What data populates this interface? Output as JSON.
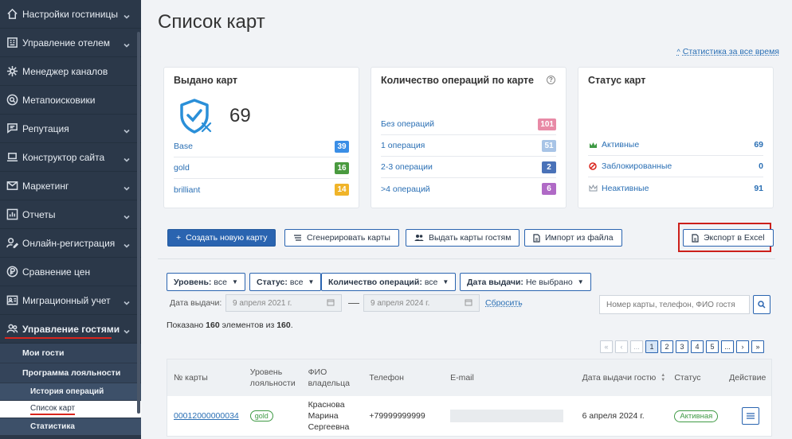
{
  "sidebar": {
    "items": [
      {
        "label": "Настройки гостиницы",
        "icon": "home-icon",
        "chevron": true
      },
      {
        "label": "Управление отелем",
        "icon": "building-icon",
        "chevron": true
      },
      {
        "label": "Менеджер каналов",
        "icon": "network-icon",
        "chevron": false
      },
      {
        "label": "Метапоисковики",
        "icon": "search-circle-icon",
        "chevron": false
      },
      {
        "label": "Репутация",
        "icon": "chat-icon",
        "chevron": true
      },
      {
        "label": "Конструктор сайта",
        "icon": "laptop-icon",
        "chevron": true
      },
      {
        "label": "Маркетинг",
        "icon": "mail-icon",
        "chevron": true
      },
      {
        "label": "Отчеты",
        "icon": "chart-icon",
        "chevron": true
      },
      {
        "label": "Онлайн-регистрация",
        "icon": "user-edit-icon",
        "chevron": true
      },
      {
        "label": "Сравнение цен",
        "icon": "price-icon",
        "chevron": false
      },
      {
        "label": "Миграционный учет",
        "icon": "id-card-icon",
        "chevron": true
      },
      {
        "label": "Управление гостями",
        "icon": "users-icon",
        "chevron": true
      }
    ],
    "sub_items": [
      "Мои гости",
      "Программа лояльности"
    ],
    "sub_sub_items": [
      "История операций",
      "Список карт",
      "Статистика"
    ]
  },
  "page": {
    "title": "Список карт",
    "stat_link": "Статистика за все время"
  },
  "cards_issued": {
    "title": "Выдано карт",
    "total": "69",
    "rows": [
      {
        "label": "Base",
        "value": "39",
        "color": "#3a8ee6"
      },
      {
        "label": "gold",
        "value": "16",
        "color": "#4a9a3f"
      },
      {
        "label": "brilliant",
        "value": "14",
        "color": "#f0b429"
      }
    ]
  },
  "operations": {
    "title": "Количество операций по карте",
    "rows": [
      {
        "label": "Без операций",
        "value": "101",
        "color": "#e88aa6"
      },
      {
        "label": "1 операция",
        "value": "51",
        "color": "#a8c4e6"
      },
      {
        "label": "2-3 операции",
        "value": "2",
        "color": "#4a72b8"
      },
      {
        "label": ">4 операций",
        "value": "6",
        "color": "#b06ac6"
      }
    ]
  },
  "card_status": {
    "title": "Статус карт",
    "rows": [
      {
        "label": "Активные",
        "value": "69",
        "icon": "crown-icon"
      },
      {
        "label": "Заблокированные",
        "value": "0",
        "icon": "blocked-icon"
      },
      {
        "label": "Неактивные",
        "value": "91",
        "icon": "crown-outline-icon"
      }
    ]
  },
  "actions": {
    "create": "Создать новую карту",
    "generate": "Сгенерировать карты",
    "issue": "Выдать карты гостям",
    "import": "Импорт из файла",
    "export": "Экспорт в Excel"
  },
  "filters": {
    "level": {
      "label": "Уровень:",
      "value": "все"
    },
    "status": {
      "label": "Статус:",
      "value": "все"
    },
    "ops": {
      "label": "Количество операций:",
      "value": "все"
    },
    "date": {
      "label": "Дата выдачи:",
      "value": "Не выбрано"
    },
    "date_label": "Дата выдачи:",
    "date_from": "9 апреля 2021 г.",
    "date_to": "9 апреля 2024 г.",
    "dash": "—",
    "reset": "Сбросить",
    "search_placeholder": "Номер карты, телефон, ФИО гостя"
  },
  "summary": {
    "pre": "Показано ",
    "shown": "160",
    "mid": " элементов из ",
    "total": "160",
    "post": "."
  },
  "pagination": [
    "«",
    "‹",
    "...",
    "1",
    "2",
    "3",
    "4",
    "5",
    "...",
    "›",
    "»"
  ],
  "table": {
    "headers": [
      "№ карты",
      "Уровень лояльности",
      "ФИО владельца",
      "Телефон",
      "E-mail",
      "Дата выдачи гостю",
      "Статус",
      "Действие"
    ],
    "rows": [
      {
        "card": "00012000000034",
        "level": "gold",
        "name": "Краснова Марина Сергеевна",
        "phone": "+79999999999",
        "email": "",
        "date": "6 апреля 2024 г.",
        "status": "Активная"
      }
    ]
  }
}
